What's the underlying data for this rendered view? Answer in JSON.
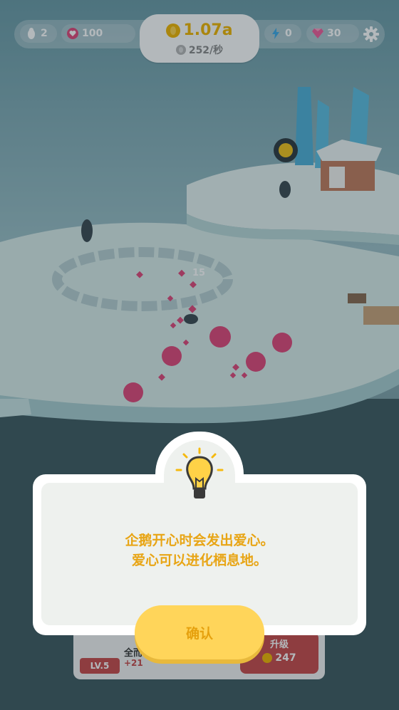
{
  "hud": {
    "penguins": "2",
    "hearts": "100",
    "coins_total": "1.07a",
    "coins_rate": "252/秒",
    "energy": "0",
    "gems": "30"
  },
  "scene": {
    "heart_popup": "15"
  },
  "dialog": {
    "line1": "企鹅开心时会发出爱心。",
    "line2": "爱心可以进化栖息地。",
    "confirm_label": "确认"
  },
  "bottom_panel": {
    "level": "LV.5",
    "name_partial": "全而",
    "bonus": "+21",
    "upgrade_label": "升级",
    "upgrade_cost": "247"
  },
  "colors": {
    "accent_yellow": "#ffd55a",
    "text_orange": "#e8a515",
    "heart_pink": "#e0487a",
    "coin_gold": "#f2b600"
  },
  "icons": [
    "penguin-icon",
    "heart-icon",
    "coin-icon",
    "silver-coin-icon",
    "lightning-icon",
    "gem-icon",
    "gear-icon",
    "lightbulb-icon"
  ]
}
